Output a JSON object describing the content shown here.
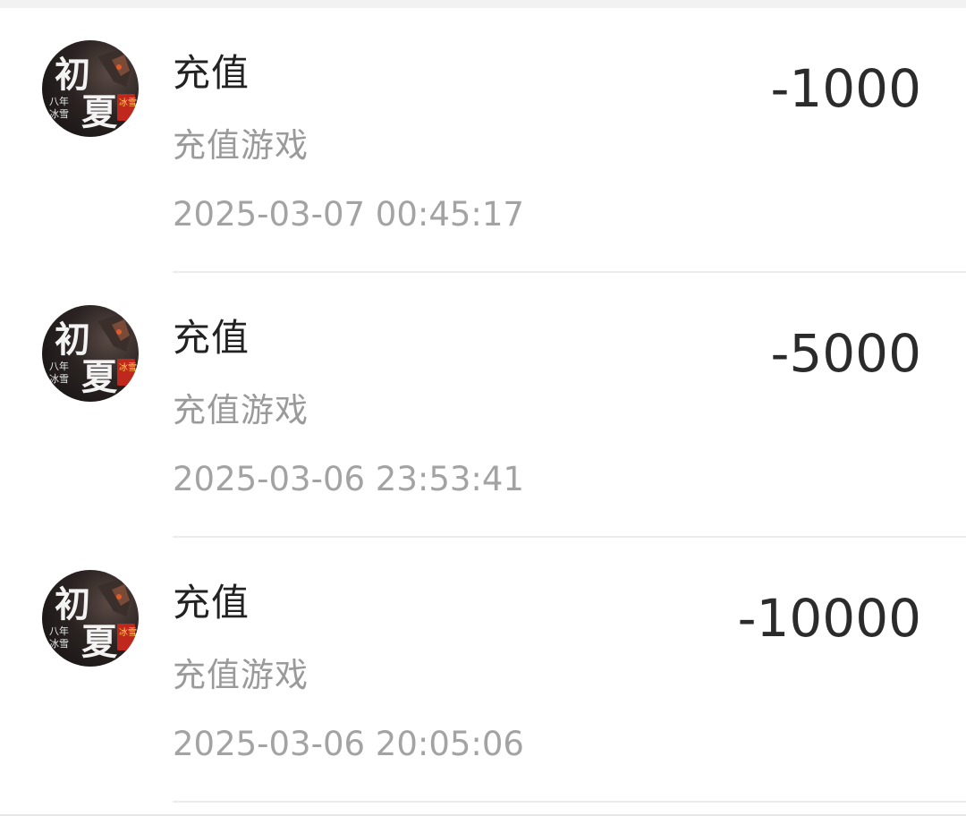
{
  "transactions": [
    {
      "title": "充值",
      "subtitle": "充值游戏",
      "time": "2025-03-07 00:45:17",
      "amount": "-1000",
      "avatar_icon": "game-logo-chuxia"
    },
    {
      "title": "充值",
      "subtitle": "充值游戏",
      "time": "2025-03-06 23:53:41",
      "amount": "-5000",
      "avatar_icon": "game-logo-chuxia"
    },
    {
      "title": "充值",
      "subtitle": "充值游戏",
      "time": "2025-03-06 20:05:06",
      "amount": "-10000",
      "avatar_icon": "game-logo-chuxia"
    }
  ],
  "avatar_logo": {
    "main_char_1": "初",
    "main_char_2": "夏",
    "side_text_1": "八年",
    "side_text_2": "冰雪",
    "badge_text": "冰雪"
  },
  "colors": {
    "title": "#222222",
    "subtitle": "#9a9a9a",
    "amount": "#2b2b2b",
    "badge": "#c0281e"
  }
}
